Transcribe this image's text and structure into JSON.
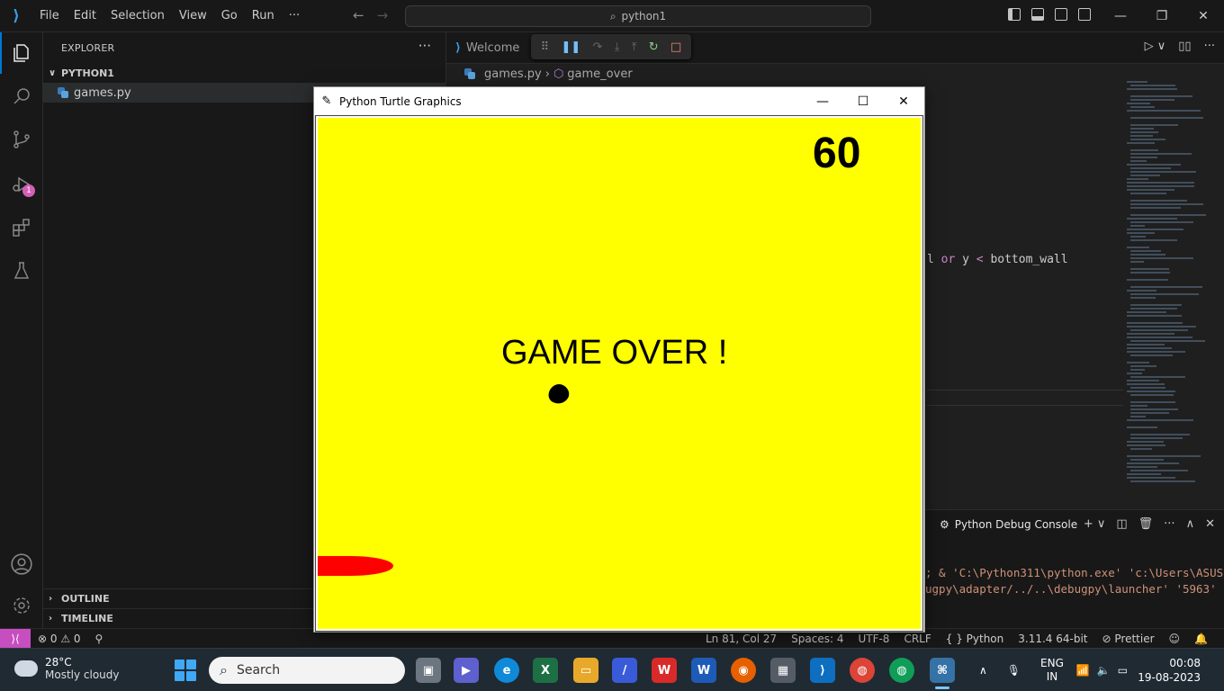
{
  "titlebar": {
    "menu": [
      "File",
      "Edit",
      "Selection",
      "View",
      "Go",
      "Run",
      "···"
    ],
    "search_text": "python1"
  },
  "activity": {
    "debug_badge": "1"
  },
  "sidebar": {
    "title": "EXPLORER",
    "folder": "PYTHON1",
    "file": "games.py",
    "outline": "OUTLINE",
    "timeline": "TIMELINE"
  },
  "editor": {
    "tab_label": "Welcome",
    "breadcrumb_file": "games.py",
    "breadcrumb_symbol": "game_over",
    "code_visible": {
      "prefix": "l ",
      "kw_or": "or",
      "rest_a": " y ",
      "op": "<",
      "rest_b": " bottom_wall"
    }
  },
  "panel": {
    "title": "Python Debug Console",
    "line1": "; & 'C:\\Python311\\python.exe' 'c:\\Users\\ASUS",
    "line2": "ugpy\\adapter/../..\\debugpy\\launcher' '5963'"
  },
  "statusbar": {
    "errors": "0",
    "warnings": "0",
    "cursor": "Ln 81, Col 27",
    "spaces": "Spaces: 4",
    "encoding": "UTF-8",
    "eol": "CRLF",
    "language": "Python",
    "interpreter": "3.11.4 64-bit",
    "formatter": "Prettier"
  },
  "turtle": {
    "window_title": "Python Turtle Graphics",
    "score": "60",
    "message": "GAME OVER !",
    "bg_color": "#ffff00"
  },
  "taskbar": {
    "temp": "28°C",
    "weather": "Mostly cloudy",
    "search_placeholder": "Search",
    "lang": "ENG",
    "region": "IN",
    "time": "00:08",
    "date": "19-08-2023"
  }
}
